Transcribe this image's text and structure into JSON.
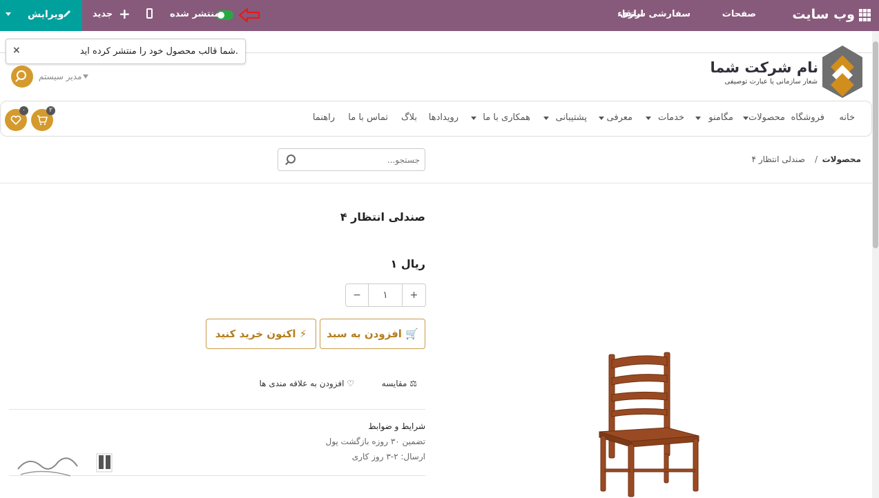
{
  "topbar": {
    "app_name": "وب سایت",
    "menu": [
      "صفحات",
      "سفارشی سازی",
      "ارتقاء"
    ],
    "published_label": "منتشر شده",
    "new_label": "جدید",
    "edit_label": "ویرایش",
    "colors": {
      "bar": "#875a7b",
      "edit": "#00a09d",
      "toggle_on": "#28a745"
    }
  },
  "toast": {
    "message": "شما قالب محصول خود را منتشر کرده اید.",
    "close": "×"
  },
  "header": {
    "company_name": "نام شرکت شما",
    "slogan": "شعار سازمانی یا عبارت توصیفی",
    "user": "مدیر سیستم"
  },
  "nav": {
    "items": [
      "خانه",
      "فروشگاه",
      "محصولات",
      "مگامنو",
      "خدمات",
      "معرفی",
      "پشتیبانی",
      "همکاری با ما",
      "رویدادها",
      "بلاگ",
      "تماس با ما",
      "راهنما"
    ],
    "cart_count": "۲",
    "wishlist_count": "۰",
    "accent": "#d49a2e"
  },
  "breadcrumb": {
    "root": "محصولات",
    "separator": "/",
    "current": "صندلی انتظار ۴"
  },
  "search": {
    "placeholder": "جستجو..."
  },
  "product": {
    "name": "صندلی انتظار ۴",
    "price": "۱ ریال",
    "quantity": "۱",
    "minus": "−",
    "plus": "+",
    "add_to_cart": "افزودن به سبد",
    "buy_now": "اکنون خرید کنید",
    "compare": "مقایسه",
    "wishlist": "افزودن به علاقه مندی ها",
    "terms_title": "شرایط و ضوابط",
    "terms_lines": [
      "تضمین ۳۰ روزه بازگشت پول",
      "ارسال: ۲-۳ روز کاری"
    ]
  }
}
